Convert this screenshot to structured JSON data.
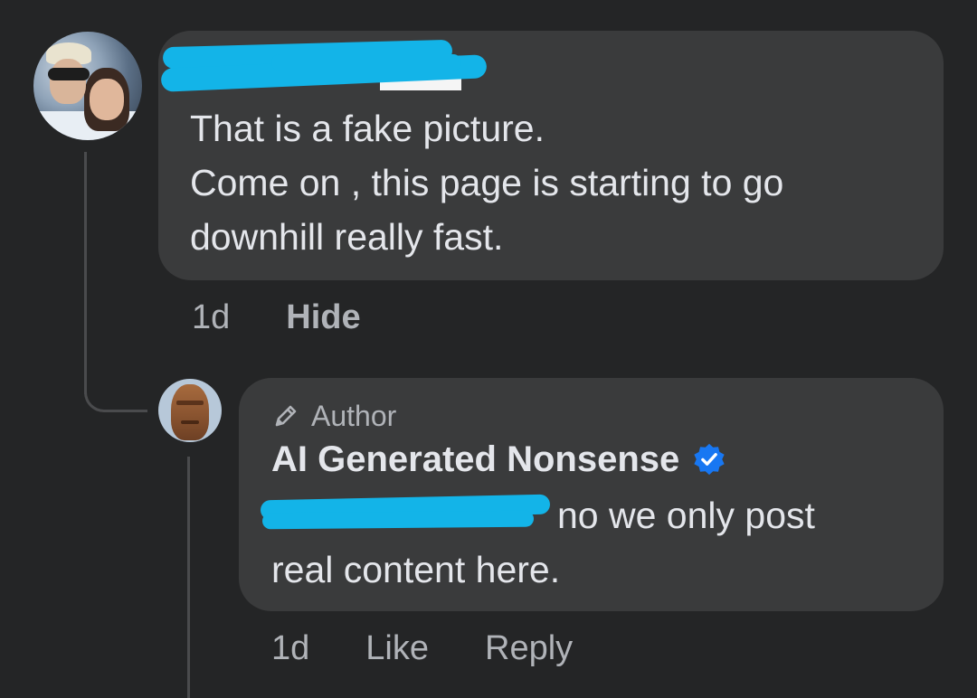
{
  "comment": {
    "text": "That is a fake picture.\nCome on , this page is starting to go\ndownhill really fast.",
    "time": "1d",
    "hide_label": "Hide"
  },
  "reply": {
    "author_badge": "Author",
    "author_name": "AI Generated Nonsense",
    "text_line1": "no we only post",
    "text_line2": "real content here.",
    "time": "1d",
    "like_label": "Like",
    "reply_label": "Reply"
  },
  "colors": {
    "background": "#242526",
    "bubble": "#3a3b3c",
    "redaction": "#13b4e8",
    "verified": "#1877f2"
  }
}
